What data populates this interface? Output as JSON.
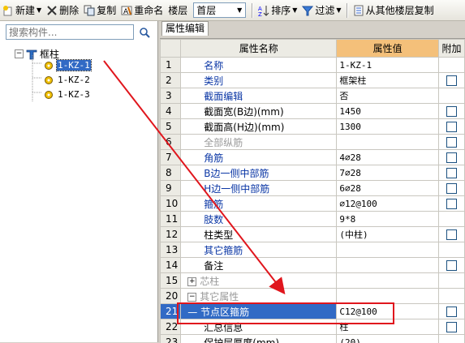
{
  "toolbar": {
    "new_label": "新建",
    "delete_label": "删除",
    "copy_label": "复制",
    "rename_label": "重命名",
    "floor_label": "楼层",
    "floor_value": "首层",
    "sort_label": "排序",
    "filter_label": "过滤",
    "copy_other_label": "从其他楼层复制"
  },
  "left": {
    "search_placeholder": "搜索构件...",
    "tree": {
      "root_label": "框柱",
      "items": [
        "1-KZ-1",
        "1-KZ-2",
        "1-KZ-3"
      ],
      "selected": "1-KZ-1"
    }
  },
  "right": {
    "tab_label": "属性编辑",
    "headers": {
      "name": "属性名称",
      "value": "属性值",
      "append": "附加"
    },
    "rows": [
      {
        "num": "1",
        "name": "名称",
        "value": "1-KZ-1",
        "style": "blue",
        "check": false
      },
      {
        "num": "2",
        "name": "类别",
        "value": "框架柱",
        "style": "blue",
        "check": true
      },
      {
        "num": "3",
        "name": "截面编辑",
        "value": "否",
        "style": "blue",
        "check": false
      },
      {
        "num": "4",
        "name": "截面宽(B边)(mm)",
        "value": "1450",
        "style": "",
        "check": true
      },
      {
        "num": "5",
        "name": "截面高(H边)(mm)",
        "value": "1300",
        "style": "",
        "check": true
      },
      {
        "num": "6",
        "name": "全部纵筋",
        "value": "",
        "style": "gray",
        "check": true
      },
      {
        "num": "7",
        "name": "角筋",
        "value": "4⌀28",
        "style": "blue",
        "check": true
      },
      {
        "num": "8",
        "name": "B边一侧中部筋",
        "value": "7⌀28",
        "style": "blue",
        "check": true
      },
      {
        "num": "9",
        "name": "H边一侧中部筋",
        "value": "6⌀28",
        "style": "blue",
        "check": true
      },
      {
        "num": "10",
        "name": "箍筋",
        "value": "⌀12@100",
        "style": "blue",
        "check": true
      },
      {
        "num": "11",
        "name": "肢数",
        "value": "9*8",
        "style": "blue",
        "check": false
      },
      {
        "num": "12",
        "name": "柱类型",
        "value": "(中柱)",
        "style": "",
        "check": true
      },
      {
        "num": "13",
        "name": "其它箍筋",
        "value": "",
        "style": "blue",
        "check": false
      },
      {
        "num": "14",
        "name": "备注",
        "value": "",
        "style": "",
        "check": true
      },
      {
        "num": "15",
        "name": "芯柱",
        "value": "",
        "style": "gray",
        "check": false,
        "group": "+"
      },
      {
        "num": "20",
        "name": "其它属性",
        "value": "",
        "style": "gray",
        "check": false,
        "group": "−"
      },
      {
        "num": "21",
        "name": "节点区箍筋",
        "value": "C12@100",
        "style": "hl",
        "check": true
      },
      {
        "num": "22",
        "name": "汇总信息",
        "value": "柱",
        "style": "",
        "check": true
      },
      {
        "num": "23",
        "name": "保护层厚度(mm)",
        "value": "(20)",
        "style": "",
        "check": false
      }
    ]
  },
  "colors": {
    "accent": "#316ac5",
    "annotation": "#e0161d",
    "value_header": "#f4c07a"
  }
}
